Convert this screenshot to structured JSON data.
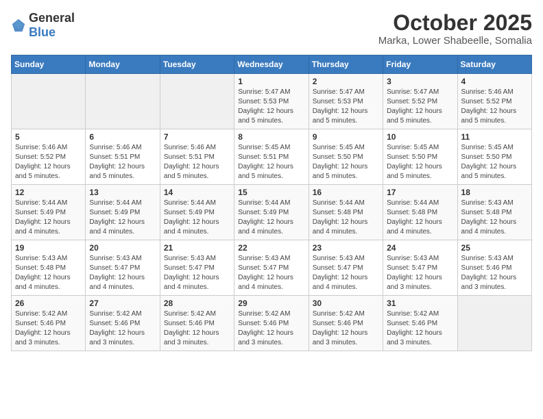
{
  "logo": {
    "general": "General",
    "blue": "Blue"
  },
  "header": {
    "month": "October 2025",
    "location": "Marka, Lower Shabeelle, Somalia"
  },
  "weekdays": [
    "Sunday",
    "Monday",
    "Tuesday",
    "Wednesday",
    "Thursday",
    "Friday",
    "Saturday"
  ],
  "weeks": [
    [
      {
        "day": "",
        "info": ""
      },
      {
        "day": "",
        "info": ""
      },
      {
        "day": "",
        "info": ""
      },
      {
        "day": "1",
        "info": "Sunrise: 5:47 AM\nSunset: 5:53 PM\nDaylight: 12 hours\nand 5 minutes."
      },
      {
        "day": "2",
        "info": "Sunrise: 5:47 AM\nSunset: 5:53 PM\nDaylight: 12 hours\nand 5 minutes."
      },
      {
        "day": "3",
        "info": "Sunrise: 5:47 AM\nSunset: 5:52 PM\nDaylight: 12 hours\nand 5 minutes."
      },
      {
        "day": "4",
        "info": "Sunrise: 5:46 AM\nSunset: 5:52 PM\nDaylight: 12 hours\nand 5 minutes."
      }
    ],
    [
      {
        "day": "5",
        "info": "Sunrise: 5:46 AM\nSunset: 5:52 PM\nDaylight: 12 hours\nand 5 minutes."
      },
      {
        "day": "6",
        "info": "Sunrise: 5:46 AM\nSunset: 5:51 PM\nDaylight: 12 hours\nand 5 minutes."
      },
      {
        "day": "7",
        "info": "Sunrise: 5:46 AM\nSunset: 5:51 PM\nDaylight: 12 hours\nand 5 minutes."
      },
      {
        "day": "8",
        "info": "Sunrise: 5:45 AM\nSunset: 5:51 PM\nDaylight: 12 hours\nand 5 minutes."
      },
      {
        "day": "9",
        "info": "Sunrise: 5:45 AM\nSunset: 5:50 PM\nDaylight: 12 hours\nand 5 minutes."
      },
      {
        "day": "10",
        "info": "Sunrise: 5:45 AM\nSunset: 5:50 PM\nDaylight: 12 hours\nand 5 minutes."
      },
      {
        "day": "11",
        "info": "Sunrise: 5:45 AM\nSunset: 5:50 PM\nDaylight: 12 hours\nand 5 minutes."
      }
    ],
    [
      {
        "day": "12",
        "info": "Sunrise: 5:44 AM\nSunset: 5:49 PM\nDaylight: 12 hours\nand 4 minutes."
      },
      {
        "day": "13",
        "info": "Sunrise: 5:44 AM\nSunset: 5:49 PM\nDaylight: 12 hours\nand 4 minutes."
      },
      {
        "day": "14",
        "info": "Sunrise: 5:44 AM\nSunset: 5:49 PM\nDaylight: 12 hours\nand 4 minutes."
      },
      {
        "day": "15",
        "info": "Sunrise: 5:44 AM\nSunset: 5:49 PM\nDaylight: 12 hours\nand 4 minutes."
      },
      {
        "day": "16",
        "info": "Sunrise: 5:44 AM\nSunset: 5:48 PM\nDaylight: 12 hours\nand 4 minutes."
      },
      {
        "day": "17",
        "info": "Sunrise: 5:44 AM\nSunset: 5:48 PM\nDaylight: 12 hours\nand 4 minutes."
      },
      {
        "day": "18",
        "info": "Sunrise: 5:43 AM\nSunset: 5:48 PM\nDaylight: 12 hours\nand 4 minutes."
      }
    ],
    [
      {
        "day": "19",
        "info": "Sunrise: 5:43 AM\nSunset: 5:48 PM\nDaylight: 12 hours\nand 4 minutes."
      },
      {
        "day": "20",
        "info": "Sunrise: 5:43 AM\nSunset: 5:47 PM\nDaylight: 12 hours\nand 4 minutes."
      },
      {
        "day": "21",
        "info": "Sunrise: 5:43 AM\nSunset: 5:47 PM\nDaylight: 12 hours\nand 4 minutes."
      },
      {
        "day": "22",
        "info": "Sunrise: 5:43 AM\nSunset: 5:47 PM\nDaylight: 12 hours\nand 4 minutes."
      },
      {
        "day": "23",
        "info": "Sunrise: 5:43 AM\nSunset: 5:47 PM\nDaylight: 12 hours\nand 4 minutes."
      },
      {
        "day": "24",
        "info": "Sunrise: 5:43 AM\nSunset: 5:47 PM\nDaylight: 12 hours\nand 3 minutes."
      },
      {
        "day": "25",
        "info": "Sunrise: 5:43 AM\nSunset: 5:46 PM\nDaylight: 12 hours\nand 3 minutes."
      }
    ],
    [
      {
        "day": "26",
        "info": "Sunrise: 5:42 AM\nSunset: 5:46 PM\nDaylight: 12 hours\nand 3 minutes."
      },
      {
        "day": "27",
        "info": "Sunrise: 5:42 AM\nSunset: 5:46 PM\nDaylight: 12 hours\nand 3 minutes."
      },
      {
        "day": "28",
        "info": "Sunrise: 5:42 AM\nSunset: 5:46 PM\nDaylight: 12 hours\nand 3 minutes."
      },
      {
        "day": "29",
        "info": "Sunrise: 5:42 AM\nSunset: 5:46 PM\nDaylight: 12 hours\nand 3 minutes."
      },
      {
        "day": "30",
        "info": "Sunrise: 5:42 AM\nSunset: 5:46 PM\nDaylight: 12 hours\nand 3 minutes."
      },
      {
        "day": "31",
        "info": "Sunrise: 5:42 AM\nSunset: 5:46 PM\nDaylight: 12 hours\nand 3 minutes."
      },
      {
        "day": "",
        "info": ""
      }
    ]
  ]
}
